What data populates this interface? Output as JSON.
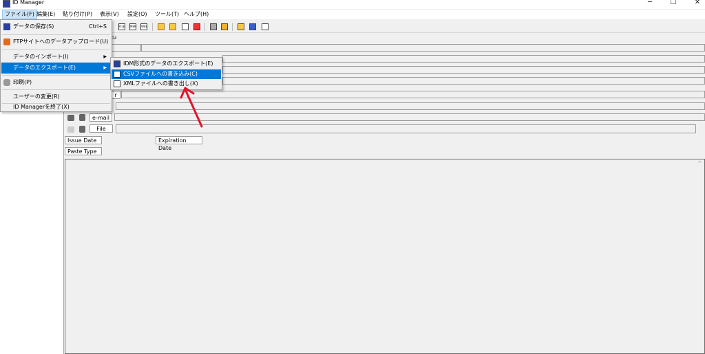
{
  "window": {
    "title": "ID Manager",
    "controls": {
      "minimize": "─",
      "maximize": "☐",
      "close": "✕"
    }
  },
  "menubar": [
    {
      "label": "ファイル(F)"
    },
    {
      "label": "編集(E)"
    },
    {
      "label": "貼り付け(P)"
    },
    {
      "label": "表示(V)"
    },
    {
      "label": "設定(O)"
    },
    {
      "label": "ツール(T)"
    },
    {
      "label": "ヘルプ(H)"
    }
  ],
  "toolbar": {
    "icons": [
      "file-icon",
      "memo-icon",
      "web-icon",
      "pwd-icon",
      "folder-add-icon",
      "folder-move-icon",
      "new-item-icon",
      "delete-icon",
      "print-icon",
      "lock-icon",
      "find-icon",
      "window-icon",
      "fullscreen-icon"
    ]
  },
  "form": {
    "url_fragment": "tu",
    "field_fragment": "r",
    "email_label": "e-mail",
    "file_label": "File",
    "issue_date_label": "Issue Date",
    "expiration_date_label": "Expiration Date",
    "paste_type_label": "Paste Type"
  },
  "file_menu": {
    "items": [
      {
        "label": "データの保存(S)",
        "shortcut": "Ctrl+S",
        "icon": "save-icon"
      },
      {
        "label": "FTPサイトへのデータアップロード(U)",
        "icon": "ftp-icon"
      },
      {
        "label": "データのインポート(I)",
        "submenu_arrow": "▶"
      },
      {
        "label": "データのエクスポート(E)",
        "submenu_arrow": "▶"
      },
      {
        "label": "印刷(P)",
        "icon": "print-icon"
      },
      {
        "label": "ユーザーの変更(R)"
      },
      {
        "label": "ID Managerを終了(X)"
      }
    ]
  },
  "export_submenu": {
    "items": [
      {
        "label": "IDM形式のデータのエクスポート(E)",
        "icon": "idm-export-icon"
      },
      {
        "label": "CSVファイルへの書き込み(C)",
        "icon": "csv-icon"
      },
      {
        "label": "XMLファイルへの書き出し(X)",
        "icon": "xml-icon"
      }
    ]
  },
  "annotation": {
    "color": "#e0142a"
  },
  "colors": {
    "highlight": "#0078d7",
    "menu_bg": "#f0f0f0"
  }
}
